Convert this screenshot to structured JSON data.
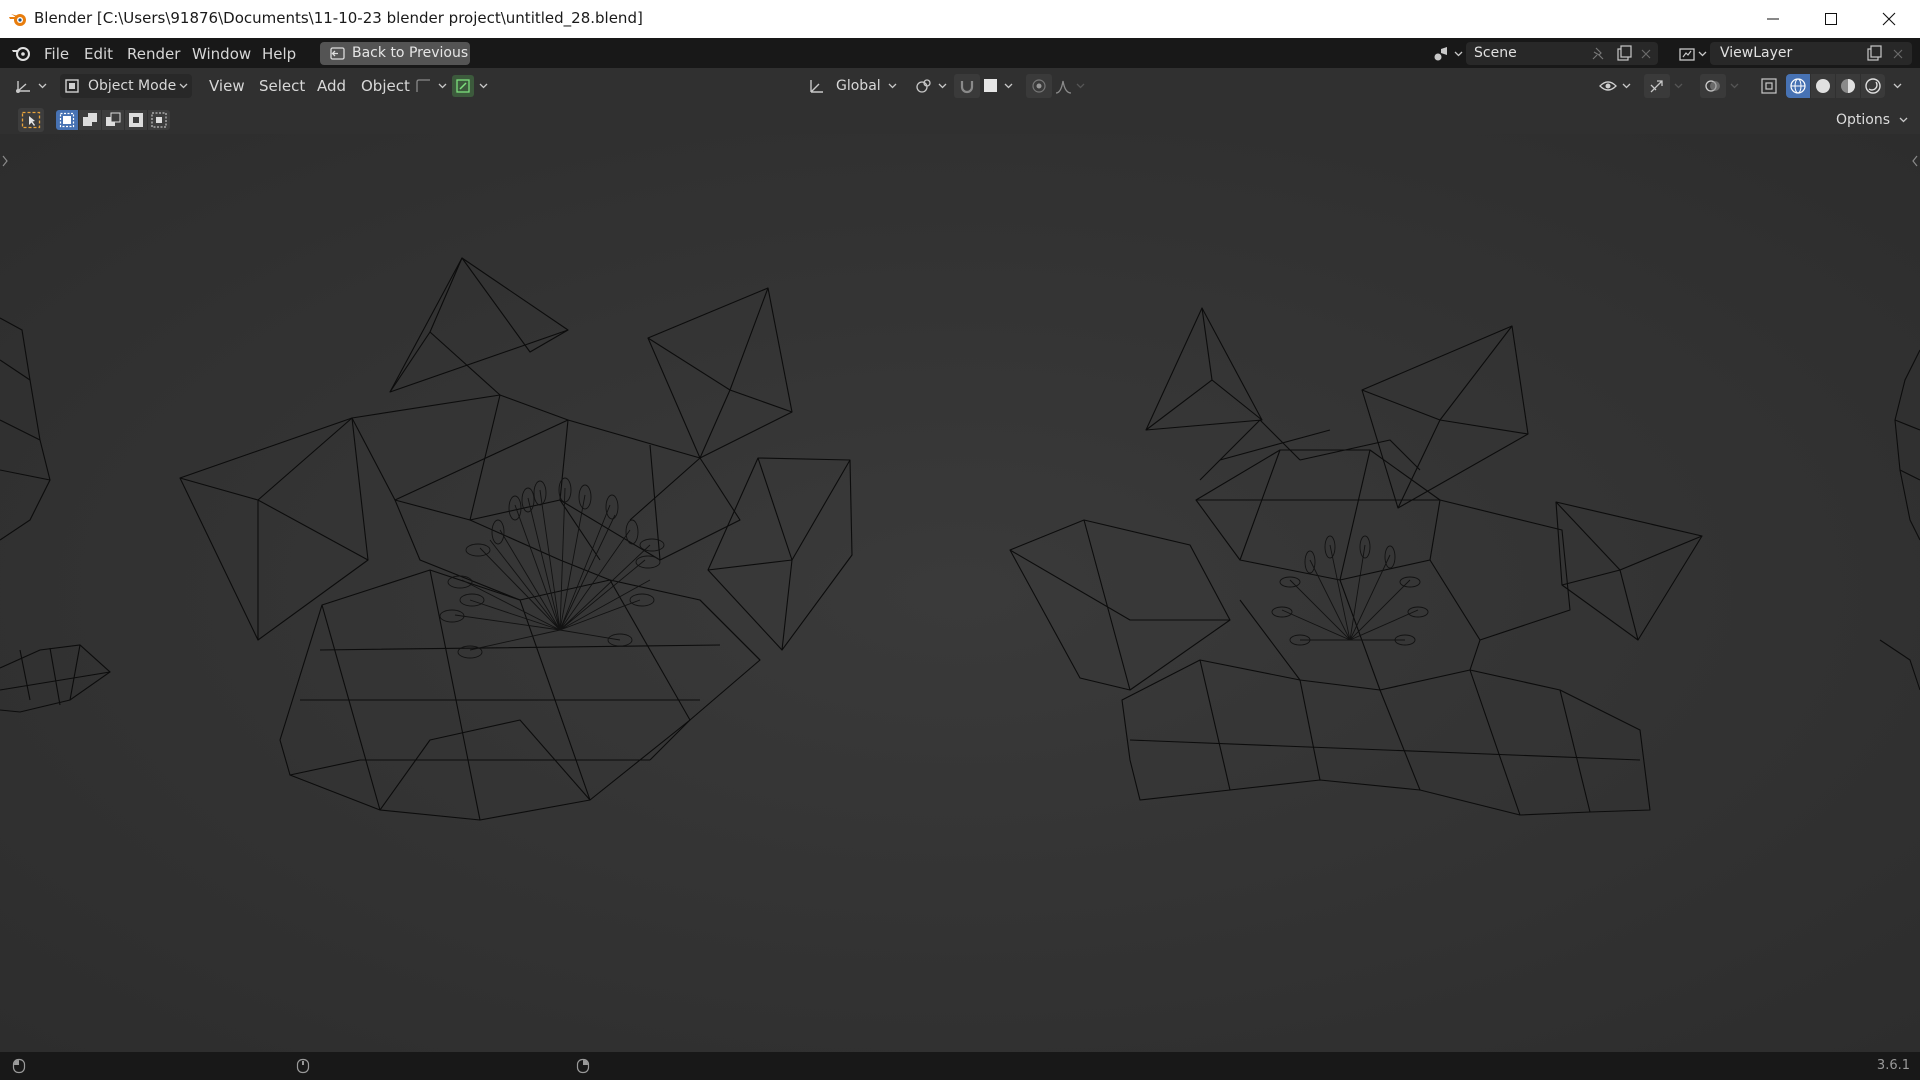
{
  "window": {
    "title": "Blender [C:\\Users\\91876\\Documents\\11-10-23 blender project\\untitled_28.blend]"
  },
  "menu": {
    "items": [
      "File",
      "Edit",
      "Render",
      "Window",
      "Help"
    ],
    "back_button": "Back to Previous"
  },
  "scene": {
    "name": "Scene"
  },
  "view_layer": {
    "name": "ViewLayer"
  },
  "viewport_header": {
    "mode": "Object Mode",
    "menus": [
      "View",
      "Select",
      "Add",
      "Object"
    ],
    "transform_orientation": "Global",
    "options_label": "Options"
  },
  "shading": {
    "active": "wireframe"
  },
  "status": {
    "version": "3.6.1"
  },
  "colors": {
    "accent": "#4772b3",
    "wire": "#0c0c0c",
    "background": "#303030",
    "topbar": "#181818"
  }
}
